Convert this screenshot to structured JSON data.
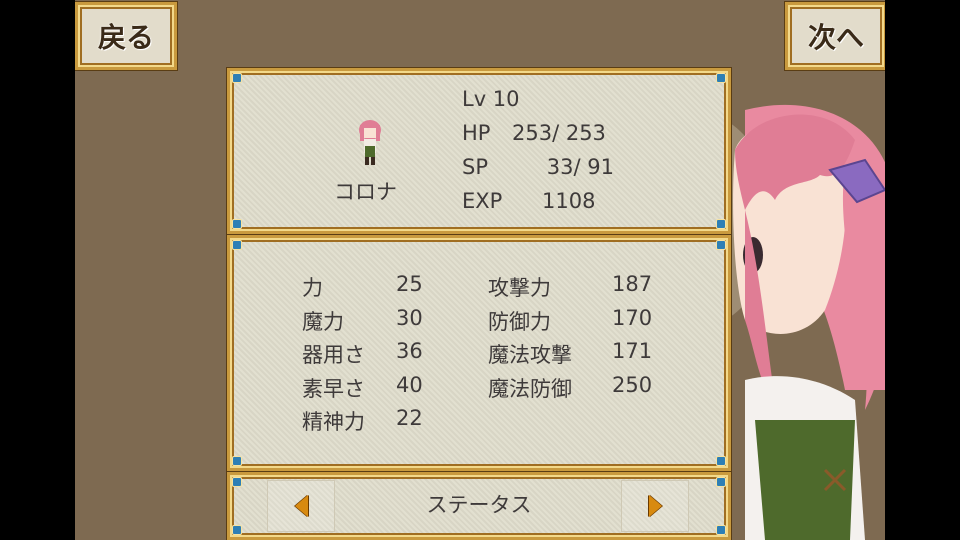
{
  "nav": {
    "back_label": "戻る",
    "next_label": "次へ"
  },
  "character": {
    "name": "コロナ",
    "level": "Lv 10",
    "hp_label": "HP",
    "hp_value": "253/ 253",
    "sp_label": "SP",
    "sp_value": "33/ 91",
    "exp_label": "EXP",
    "exp_value": "1108",
    "sprite_icon": "character-sprite-icon",
    "portrait_icon": "character-portrait"
  },
  "stats": {
    "left": [
      {
        "label": "力",
        "value": "25"
      },
      {
        "label": "魔力",
        "value": "30"
      },
      {
        "label": "器用さ",
        "value": "36"
      },
      {
        "label": "素早さ",
        "value": "40"
      },
      {
        "label": "精神力",
        "value": "22"
      }
    ],
    "right": [
      {
        "label": "攻撃力",
        "value": "187"
      },
      {
        "label": "防御力",
        "value": "170"
      },
      {
        "label": "魔法攻撃",
        "value": "171"
      },
      {
        "label": "魔法防御",
        "value": "250"
      }
    ]
  },
  "footer": {
    "page_label": "ステータス",
    "prev_icon": "triangle-left-icon",
    "next_icon": "triangle-right-icon"
  },
  "colors": {
    "background": "#7e6a51",
    "frame_gold": "#c99a3e",
    "panel_bg": "#dfdccb",
    "corner_gem": "#2e7fb5",
    "text": "#3e3a3a",
    "arrow": "#d88a10"
  }
}
